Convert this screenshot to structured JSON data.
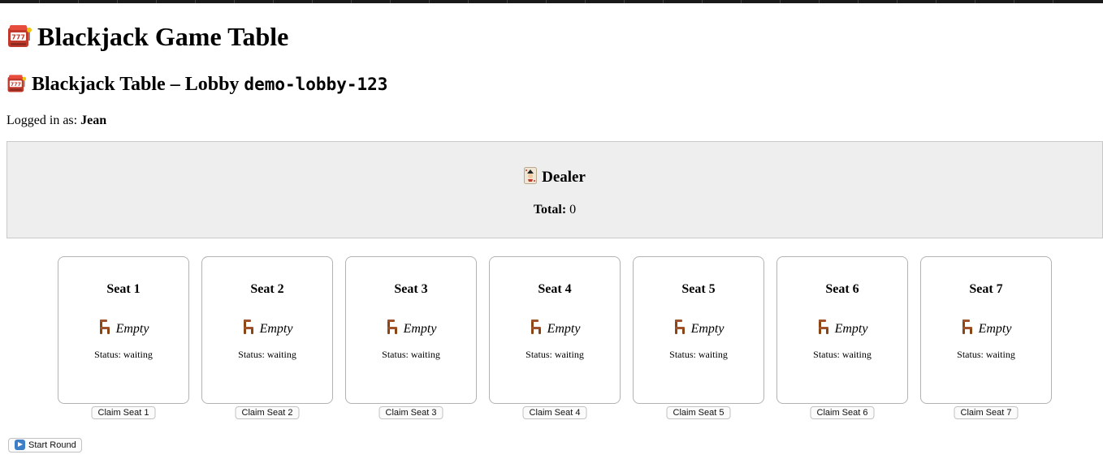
{
  "header": {
    "title": "Blackjack Game Table",
    "title_icon": "slot-machine-icon"
  },
  "lobby": {
    "prefix": "Blackjack Table – Lobby ",
    "lobby_id": "demo-lobby-123",
    "icon": "slot-machine-icon"
  },
  "session": {
    "label": "Logged in as: ",
    "username": "Jean"
  },
  "dealer": {
    "title": "Dealer",
    "icon": "joker-card-icon",
    "total_label": "Total:",
    "total_value": "0"
  },
  "seats": [
    {
      "name": "Seat 1",
      "occupant": "Empty",
      "status": "Status: waiting",
      "claim_label": "Claim Seat 1"
    },
    {
      "name": "Seat 2",
      "occupant": "Empty",
      "status": "Status: waiting",
      "claim_label": "Claim Seat 2"
    },
    {
      "name": "Seat 3",
      "occupant": "Empty",
      "status": "Status: waiting",
      "claim_label": "Claim Seat 3"
    },
    {
      "name": "Seat 4",
      "occupant": "Empty",
      "status": "Status: waiting",
      "claim_label": "Claim Seat 4"
    },
    {
      "name": "Seat 5",
      "occupant": "Empty",
      "status": "Status: waiting",
      "claim_label": "Claim Seat 5"
    },
    {
      "name": "Seat 6",
      "occupant": "Empty",
      "status": "Status: waiting",
      "claim_label": "Claim Seat 6"
    },
    {
      "name": "Seat 7",
      "occupant": "Empty",
      "status": "Status: waiting",
      "claim_label": "Claim Seat 7"
    }
  ],
  "seat_icon": "chair-icon",
  "controls": {
    "start_round_label": "Start Round",
    "start_round_icon": "play-button-icon"
  }
}
